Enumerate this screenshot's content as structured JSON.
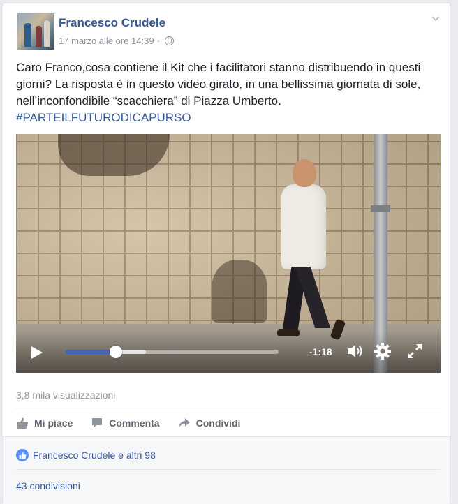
{
  "post": {
    "author": "Francesco Crudele",
    "timestamp": "17 marzo alle ore 14:39",
    "separator": "·",
    "privacy_icon": "globe-icon",
    "menu_icon": "chevron-down-icon",
    "text": "Caro Franco,cosa contiene il Kit che i facilitatori stanno distribuendo in questi giorni? La risposta è in questo video girato, in una bellissima giornata di sole, nell’inconfondibile “scacchiera” di Piazza Umberto.",
    "hashtag": "#PARTEILFUTURODICAPURSO"
  },
  "video": {
    "state": "paused",
    "play_icon": "play-icon",
    "progress_fraction": 0.24,
    "buffered_fraction": 0.38,
    "time_remaining": "-1:18",
    "volume_icon": "volume-icon",
    "settings_icon": "gear-icon",
    "fullscreen_icon": "fullscreen-icon"
  },
  "stats": {
    "views": "3,8 mila visualizzazioni"
  },
  "actions": {
    "like_label": "Mi piace",
    "comment_label": "Commenta",
    "share_label": "Condividi"
  },
  "reactions": {
    "likes_text": "Francesco Crudele e altri 98",
    "shares_text": "43 condivisioni"
  },
  "colors": {
    "link": "#365899",
    "accent": "#4267b2",
    "muted": "#90949c",
    "action_text": "#606770",
    "like_badge": "#5890ff"
  }
}
